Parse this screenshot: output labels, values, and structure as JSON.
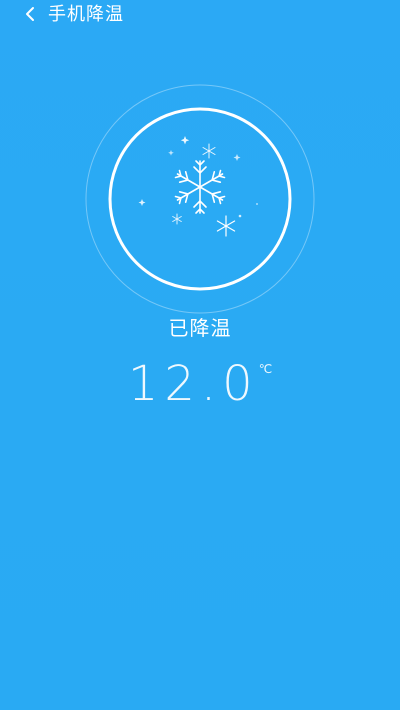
{
  "header": {
    "title": "手机降温",
    "back_icon": "chevron-left-icon"
  },
  "status": {
    "label": "已降温"
  },
  "temperature": {
    "value": "12.0",
    "unit": "℃"
  },
  "icons": {
    "main": "snowflake-icon",
    "decor": [
      "small-snowflake-icon",
      "sparkle-icon"
    ]
  },
  "colors": {
    "background": "#2aa9f4",
    "foreground": "#ffffff"
  }
}
